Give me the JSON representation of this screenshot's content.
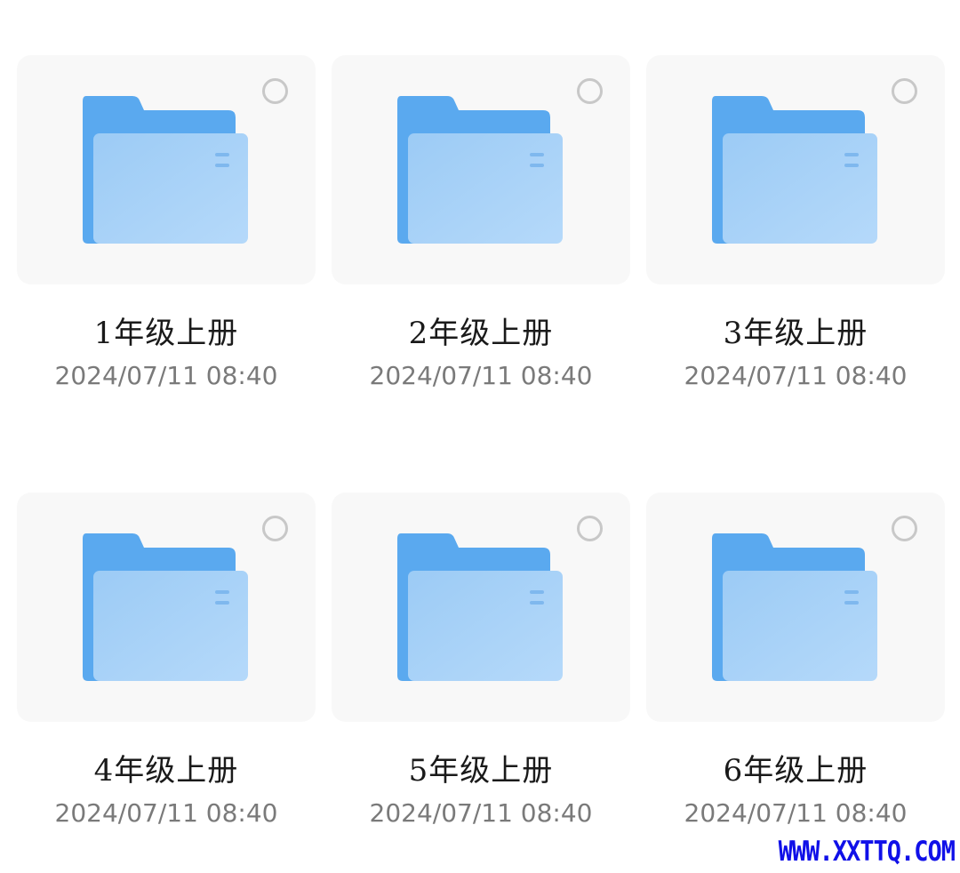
{
  "folders": [
    {
      "name": "1年级上册",
      "date": "2024/07/11 08:40",
      "selected": false,
      "icon": "folder-icon"
    },
    {
      "name": "2年级上册",
      "date": "2024/07/11 08:40",
      "selected": false,
      "icon": "folder-icon"
    },
    {
      "name": "3年级上册",
      "date": "2024/07/11 08:40",
      "selected": false,
      "icon": "folder-icon"
    },
    {
      "name": "4年级上册",
      "date": "2024/07/11 08:40",
      "selected": false,
      "icon": "folder-icon"
    },
    {
      "name": "5年级上册",
      "date": "2024/07/11 08:40",
      "selected": false,
      "icon": "folder-icon"
    },
    {
      "name": "6年级上册",
      "date": "2024/07/11 08:40",
      "selected": false,
      "icon": "folder-icon"
    }
  ],
  "watermark": "WWW.XXTTQ.COM",
  "colors": {
    "folder_back": "#5aa9ef",
    "folder_front": "#a7d0f7",
    "tile_bg": "#f8f8f8",
    "select_ring": "#c8c8c8",
    "name_text": "#1a1a1a",
    "date_text": "#7a7a7a",
    "watermark": "#1010e8"
  }
}
